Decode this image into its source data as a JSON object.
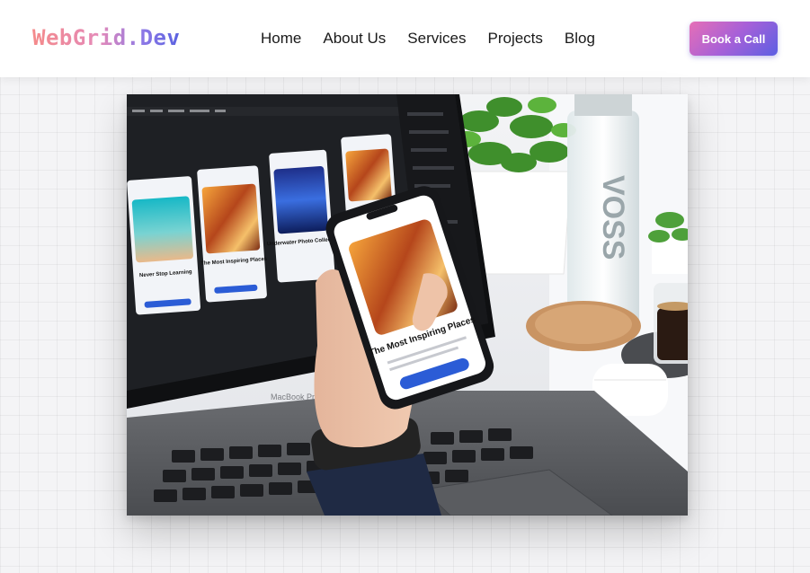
{
  "brand": {
    "logo_text": "WebGrid.Dev"
  },
  "nav": {
    "links": [
      "Home",
      "About Us",
      "Services",
      "Projects",
      "Blog"
    ],
    "cta_label": "Book a Call"
  },
  "hero": {
    "screen_cards": [
      {
        "title": "Never Stop Learning"
      },
      {
        "title": "The Most Inspiring Places"
      },
      {
        "title": "Underwater Photo Collection"
      }
    ],
    "phone_card": {
      "title": "The Most Inspiring Places"
    },
    "laptop_brand": "MacBook Pro"
  },
  "colors": {
    "cta_gradient_start": "#e66fb6",
    "cta_gradient_end": "#5c5fe3",
    "page_background": "#f4f4f6"
  }
}
